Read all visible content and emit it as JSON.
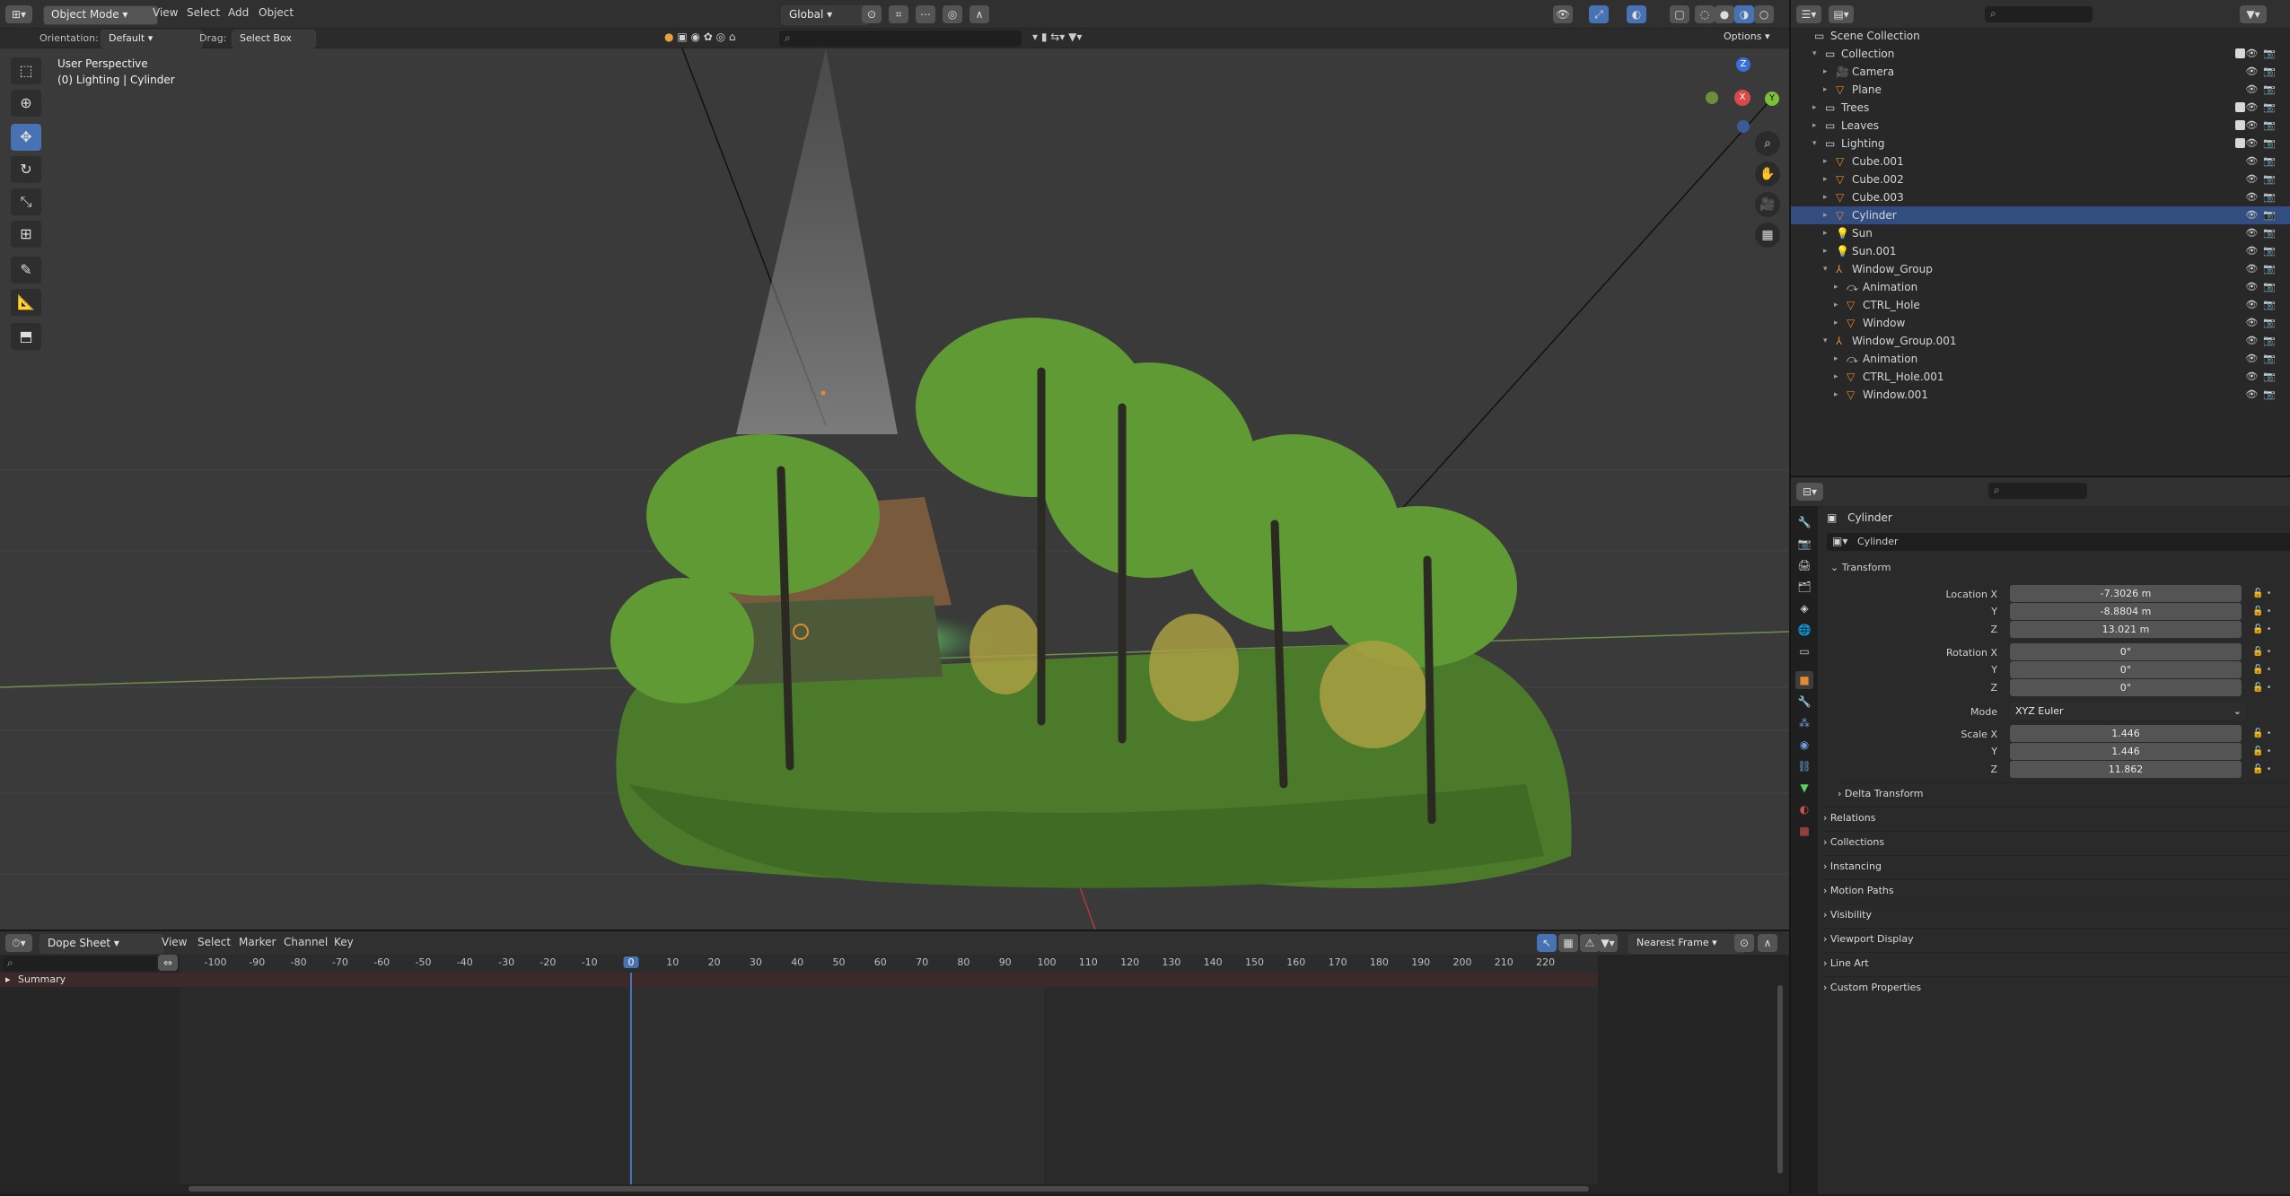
{
  "header": {
    "mode": "Object Mode",
    "menus": [
      "View",
      "Select",
      "Add",
      "Object"
    ],
    "transform_space": "Global",
    "options": "Options"
  },
  "subheader": {
    "orientation_label": "Orientation:",
    "orientation_value": "Default",
    "drag_label": "Drag:",
    "drag_value": "Select Box"
  },
  "viewport": {
    "perspective": "User Perspective",
    "context": "(0) Lighting | Cylinder",
    "gizmo": {
      "z": "Z",
      "x": "X",
      "y": "Y"
    }
  },
  "toolbar": {
    "tools": [
      "select-box",
      "cursor",
      "move",
      "rotate",
      "scale",
      "transform",
      "annotate",
      "measure",
      "add-cube"
    ]
  },
  "outliner": {
    "search_placeholder": "",
    "rows": [
      {
        "label": "Scene Collection",
        "indent": 0,
        "type": "scene",
        "expanded": true
      },
      {
        "label": "Collection",
        "indent": 1,
        "type": "collection",
        "expanded": true,
        "check": true
      },
      {
        "label": "Camera",
        "indent": 2,
        "type": "camera"
      },
      {
        "label": "Plane",
        "indent": 2,
        "type": "mesh"
      },
      {
        "label": "Trees",
        "indent": 1,
        "type": "collection",
        "check": true
      },
      {
        "label": "Leaves",
        "indent": 1,
        "type": "collection",
        "check": true
      },
      {
        "label": "Lighting",
        "indent": 1,
        "type": "collection",
        "expanded": true,
        "check": true
      },
      {
        "label": "Cube.001",
        "indent": 2,
        "type": "mesh"
      },
      {
        "label": "Cube.002",
        "indent": 2,
        "type": "mesh"
      },
      {
        "label": "Cube.003",
        "indent": 2,
        "type": "mesh"
      },
      {
        "label": "Cylinder",
        "indent": 2,
        "type": "mesh",
        "selected": true
      },
      {
        "label": "Sun",
        "indent": 2,
        "type": "light"
      },
      {
        "label": "Sun.001",
        "indent": 2,
        "type": "light"
      },
      {
        "label": "Window_Group",
        "indent": 2,
        "type": "empty",
        "expanded": true
      },
      {
        "label": "Animation",
        "indent": 3,
        "type": "anim"
      },
      {
        "label": "CTRL_Hole",
        "indent": 3,
        "type": "mesh"
      },
      {
        "label": "Window",
        "indent": 3,
        "type": "mesh"
      },
      {
        "label": "Window_Group.001",
        "indent": 2,
        "type": "empty",
        "expanded": true
      },
      {
        "label": "Animation",
        "indent": 3,
        "type": "anim"
      },
      {
        "label": "CTRL_Hole.001",
        "indent": 3,
        "type": "mesh"
      },
      {
        "label": "Window.001",
        "indent": 3,
        "type": "mesh"
      }
    ]
  },
  "properties": {
    "object_name": "Cylinder",
    "name_field": "Cylinder",
    "transform_label": "Transform",
    "location": {
      "label_x": "Location X",
      "label_y": "Y",
      "label_z": "Z",
      "x": "-7.3026 m",
      "y": "-8.8804 m",
      "z": "13.021 m"
    },
    "rotation": {
      "label_x": "Rotation X",
      "label_y": "Y",
      "label_z": "Z",
      "x": "0°",
      "y": "0°",
      "z": "0°"
    },
    "mode_label": "Mode",
    "mode_value": "XYZ Euler",
    "scale": {
      "label_x": "Scale X",
      "label_y": "Y",
      "label_z": "Z",
      "x": "1.446",
      "y": "1.446",
      "z": "11.862"
    },
    "sections": [
      "Delta Transform",
      "Relations",
      "Collections",
      "Instancing",
      "Motion Paths",
      "Visibility",
      "Viewport Display",
      "Line Art",
      "Custom Properties"
    ]
  },
  "timeline": {
    "editor": "Dope Sheet",
    "menus": [
      "View",
      "Select",
      "Marker",
      "Channel",
      "Key"
    ],
    "snap": "Nearest Frame",
    "current_frame": "0",
    "ticks": [
      "-100",
      "-90",
      "-80",
      "-70",
      "-60",
      "-50",
      "-40",
      "-30",
      "-20",
      "-10",
      "0",
      "10",
      "20",
      "30",
      "40",
      "50",
      "60",
      "70",
      "80",
      "90",
      "100",
      "110",
      "120",
      "130",
      "140",
      "150",
      "160",
      "170",
      "180",
      "190",
      "200",
      "210",
      "220"
    ],
    "summary": "Summary"
  },
  "colors": {
    "accent": "#4772b3",
    "selection": "#334d80",
    "grid": "#3a3a3a",
    "orange": "#e68a2e",
    "green": "#5ccf5c"
  }
}
